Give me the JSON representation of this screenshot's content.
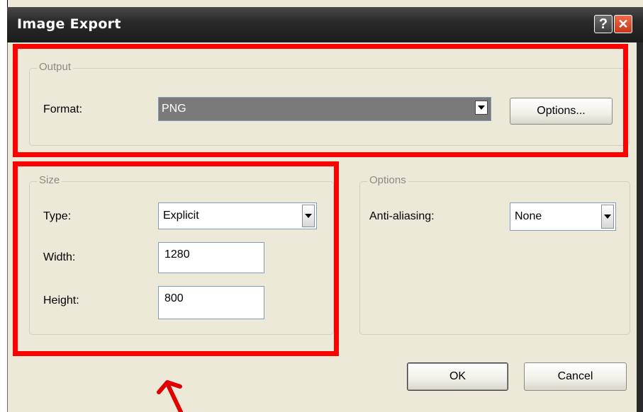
{
  "dialog": {
    "title": "Image Export",
    "help_symbol": "?",
    "close_symbol": "✕"
  },
  "output": {
    "group_label": "Output",
    "format_label": "Format:",
    "format_value": "PNG",
    "options_button": "Options..."
  },
  "size": {
    "group_label": "Size",
    "type_label": "Type:",
    "type_value": "Explicit",
    "width_label": "Width:",
    "width_value": "1280",
    "height_label": "Height:",
    "height_value": "800"
  },
  "options": {
    "group_label": "Options",
    "antialias_label": "Anti-aliasing:",
    "antialias_value": "None"
  },
  "buttons": {
    "ok": "OK",
    "cancel": "Cancel"
  },
  "annotation": {
    "highlight_color": "#ff0000",
    "arrow_color": "#e00000"
  }
}
